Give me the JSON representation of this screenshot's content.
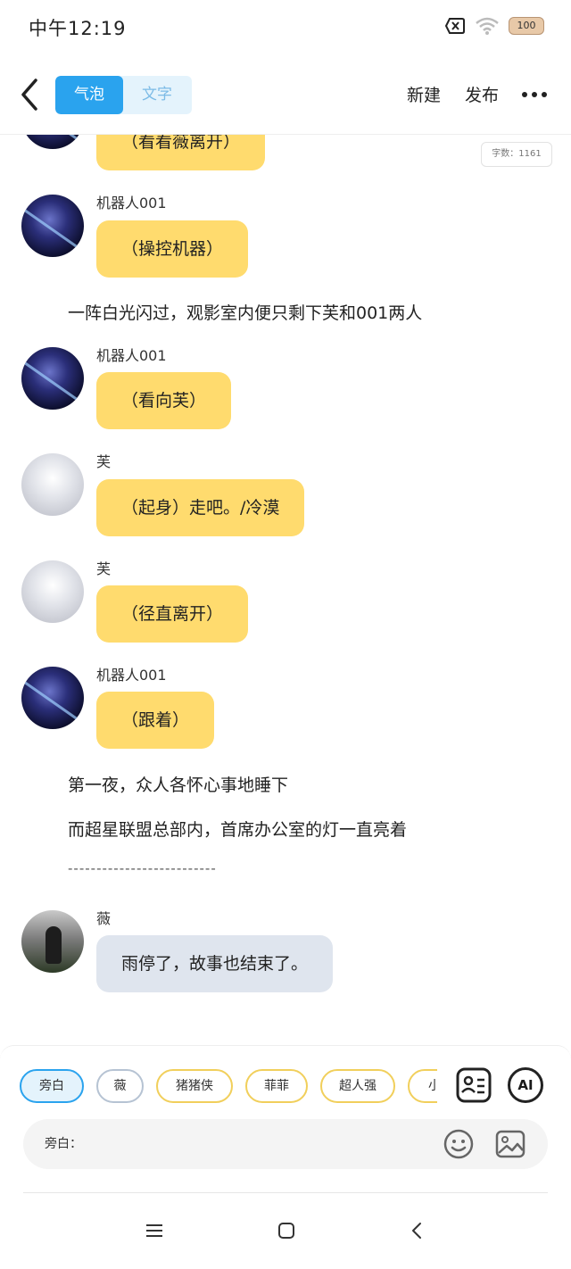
{
  "status_bar": {
    "time": "中午12:19",
    "battery": "100"
  },
  "header": {
    "tabs": [
      {
        "label": "气泡",
        "active": true
      },
      {
        "label": "文字",
        "active": false
      }
    ],
    "new_label": "新建",
    "publish_label": "发布"
  },
  "chat": {
    "word_count": "字数：1161",
    "items": [
      {
        "type": "bubble",
        "speaker": "",
        "avatar": "robot-avatar",
        "text": "（看看薇离开）"
      },
      {
        "type": "bubble",
        "speaker": "机器人001",
        "avatar": "robot-avatar",
        "text": "（操控机器）"
      },
      {
        "type": "narration",
        "text": "一阵白光闪过，观影室内便只剩下芙和001两人"
      },
      {
        "type": "bubble",
        "speaker": "机器人001",
        "avatar": "robot-avatar",
        "text": "（看向芙）"
      },
      {
        "type": "bubble",
        "speaker": "芙",
        "avatar": "fu-avatar",
        "text": "（起身）走吧。/冷漠"
      },
      {
        "type": "bubble",
        "speaker": "芙",
        "avatar": "fu-avatar",
        "text": "（径直离开）"
      },
      {
        "type": "bubble",
        "speaker": "机器人001",
        "avatar": "robot-avatar",
        "text": "（跟着）"
      },
      {
        "type": "narration",
        "text": "第一夜，众人各怀心事地睡下"
      },
      {
        "type": "narration",
        "text": "而超星联盟总部内，首席办公室的灯一直亮着"
      },
      {
        "type": "narration",
        "text": "--------------------------"
      },
      {
        "type": "bubble",
        "speaker": "薇",
        "avatar": "wei-avatar",
        "text": "雨停了，故事也结束了。"
      }
    ]
  },
  "roles": [
    {
      "label": "旁白",
      "selected": true
    },
    {
      "label": "薇",
      "selected": false
    },
    {
      "label": "猪猪侠",
      "selected": false
    },
    {
      "label": "菲菲",
      "selected": false
    },
    {
      "label": "超人强",
      "selected": false
    },
    {
      "label": "小",
      "selected": false
    }
  ],
  "tools": {
    "ai_label": "AI"
  },
  "input": {
    "label": "旁白："
  },
  "colors": {
    "accent": "#2aa3ee",
    "bubble_yellow": "#ffdb6e",
    "bubble_grey": "#dfe5ee"
  }
}
